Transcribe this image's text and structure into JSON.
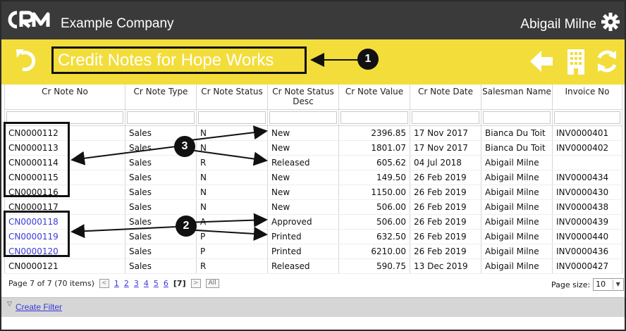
{
  "header": {
    "logo_text": "CRM",
    "company": "Example Company",
    "user": "Abigail Milne"
  },
  "page": {
    "title": "Credit Notes for Hope Works"
  },
  "grid": {
    "columns": [
      "Cr Note No",
      "Cr Note Type",
      "Cr Note Status",
      "Cr Note Status Desc",
      "Cr Note Value",
      "Cr Note Date",
      "Salesman Name",
      "Invoice No"
    ],
    "rows": [
      [
        "CN0000112",
        "Sales",
        "N",
        "New",
        "2396.85",
        "17 Nov 2017",
        "Bianca Du Toit",
        "INV0000401"
      ],
      [
        "CN0000113",
        "Sales",
        "N",
        "New",
        "1801.07",
        "17 Nov 2017",
        "Bianca Du Toit",
        "INV0000402"
      ],
      [
        "CN0000114",
        "Sales",
        "R",
        "Released",
        "605.62",
        "04 Jul 2018",
        "Abigail Milne",
        ""
      ],
      [
        "CN0000115",
        "Sales",
        "N",
        "New",
        "149.50",
        "26 Feb 2019",
        "Abigail Milne",
        "INV0000434"
      ],
      [
        "CN0000116",
        "Sales",
        "N",
        "New",
        "1150.00",
        "26 Feb 2019",
        "Abigail Milne",
        "INV0000430"
      ],
      [
        "CN0000117",
        "Sales",
        "N",
        "New",
        "506.00",
        "26 Feb 2019",
        "Abigail Milne",
        "INV0000438"
      ],
      [
        "CN0000118",
        "Sales",
        "A",
        "Approved",
        "506.00",
        "26 Feb 2019",
        "Abigail Milne",
        "INV0000439"
      ],
      [
        "CN0000119",
        "Sales",
        "P",
        "Printed",
        "632.50",
        "26 Feb 2019",
        "Abigail Milne",
        "INV0000440"
      ],
      [
        "CN0000120",
        "Sales",
        "P",
        "Printed",
        "6210.00",
        "26 Feb 2019",
        "Abigail Milne",
        "INV0000436"
      ],
      [
        "CN0000121",
        "Sales",
        "R",
        "Released",
        "590.75",
        "13 Dec 2019",
        "Abigail Milne",
        "INV0000427"
      ]
    ],
    "link_rows": [
      6,
      7,
      8
    ]
  },
  "pager": {
    "summary": "Page 7 of 7 (70 items)",
    "prev": "<",
    "pages": [
      "1",
      "2",
      "3",
      "4",
      "5",
      "6"
    ],
    "current": "[7]",
    "next": ">",
    "all": "All",
    "page_size_label": "Page size:",
    "page_size_value": "10"
  },
  "footer": {
    "create_filter": "Create Filter"
  },
  "annotations": {
    "badge_1": "1",
    "badge_2": "2",
    "badge_3": "3"
  },
  "colors": {
    "topbar": "#3a3a3a",
    "titlebar": "#f2dd3b",
    "link": "#3a3ad8"
  }
}
